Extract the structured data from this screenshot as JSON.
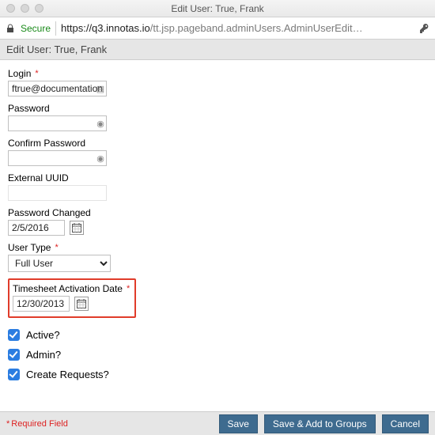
{
  "window": {
    "title": "Edit User: True, Frank"
  },
  "browser": {
    "secure_label": "Secure",
    "url_host": "https://q3.innotas.io",
    "url_path": "/tt.jsp.pageband.adminUsers.AdminUserEdit…"
  },
  "page_heading": "Edit User: True, Frank",
  "labels": {
    "login": "Login",
    "password": "Password",
    "confirm_password": "Confirm Password",
    "external_uuid": "External UUID",
    "password_changed": "Password Changed",
    "user_type": "User Type",
    "timesheet_activation_date": "Timesheet Activation Date",
    "active": "Active?",
    "admin": "Admin?",
    "create_requests": "Create Requests?"
  },
  "values": {
    "login": "ftrue@documentation",
    "password": "",
    "confirm_password": "",
    "external_uuid": "",
    "password_changed": "2/5/2016",
    "user_type": "Full User",
    "timesheet_activation_date": "12/30/2013",
    "active_checked": true,
    "admin_checked": true,
    "create_requests_checked": true
  },
  "footer": {
    "required_note": "Required Field",
    "save": "Save",
    "save_add": "Save & Add to Groups",
    "cancel": "Cancel"
  }
}
